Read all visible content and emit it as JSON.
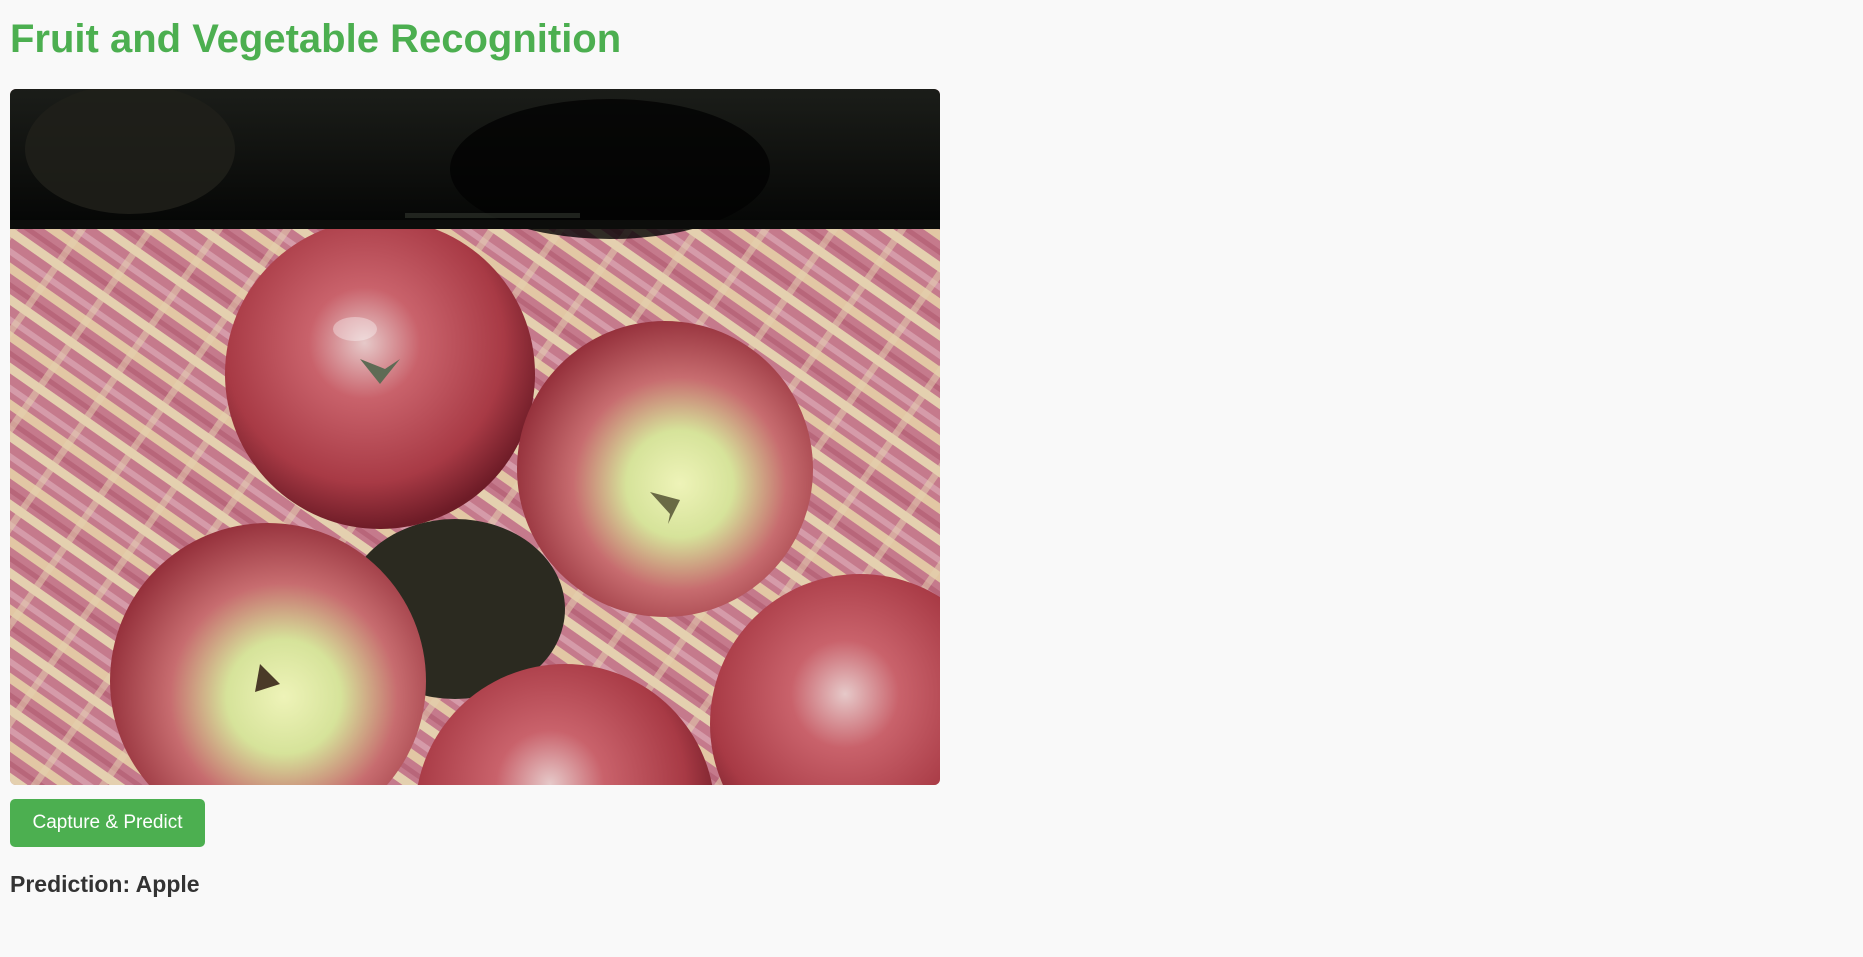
{
  "page": {
    "title": "Fruit and Vegetable Recognition"
  },
  "camera": {
    "feed_content": "apples-in-basket",
    "colors": {
      "apple_red": "#a83a45",
      "apple_highlight": "#e6c9c9",
      "apple_center": "#d6e39a",
      "basket_pink": "#c57a8c",
      "basket_cream": "#e9dcb4",
      "top_shadow": "#0c0d0b"
    }
  },
  "controls": {
    "capture_button_label": "Capture & Predict"
  },
  "result": {
    "prediction_text": "Prediction: Apple"
  },
  "theme": {
    "accent": "#4caf50",
    "background": "#f9f9f9",
    "text": "#333333"
  }
}
